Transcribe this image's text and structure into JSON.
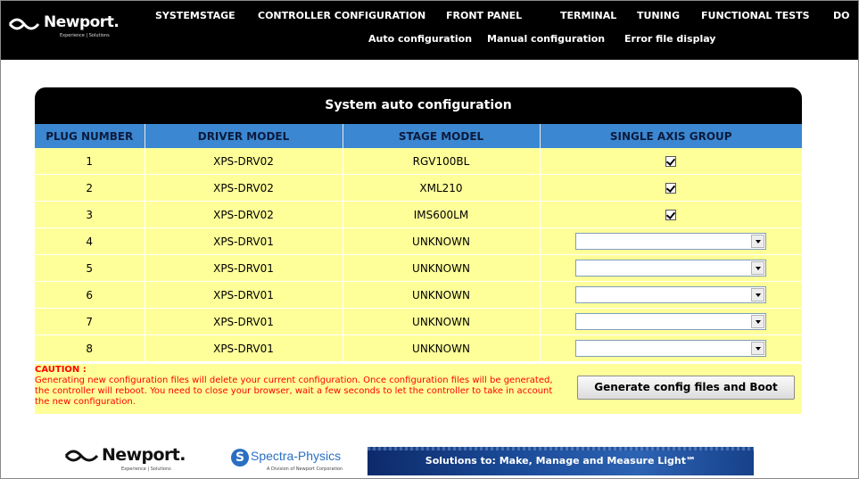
{
  "header": {
    "logo": {
      "name": "Newport.",
      "tagline": "Experience | Solutions"
    },
    "nav": [
      "SYSTEM",
      "STAGE",
      "CONTROLLER CONFIGURATION",
      "FRONT PANEL",
      "TERMINAL",
      "TUNING",
      "FUNCTIONAL TESTS",
      "DO"
    ],
    "subnav": [
      "Auto configuration",
      "Manual configuration",
      "Error file display"
    ]
  },
  "panel": {
    "title": "System auto configuration",
    "columns": [
      "PLUG NUMBER",
      "DRIVER MODEL",
      "STAGE MODEL",
      "SINGLE AXIS GROUP"
    ],
    "rows": [
      {
        "plug": "1",
        "driver": "XPS-DRV02",
        "stage": "RGV100BL",
        "single_axis_group": "checkbox-checked"
      },
      {
        "plug": "2",
        "driver": "XPS-DRV02",
        "stage": "XML210",
        "single_axis_group": "checkbox-checked"
      },
      {
        "plug": "3",
        "driver": "XPS-DRV02",
        "stage": "IMS600LM",
        "single_axis_group": "checkbox-checked"
      },
      {
        "plug": "4",
        "driver": "XPS-DRV01",
        "stage": "UNKNOWN",
        "single_axis_group": "select-empty"
      },
      {
        "plug": "5",
        "driver": "XPS-DRV01",
        "stage": "UNKNOWN",
        "single_axis_group": "select-empty"
      },
      {
        "plug": "6",
        "driver": "XPS-DRV01",
        "stage": "UNKNOWN",
        "single_axis_group": "select-empty"
      },
      {
        "plug": "7",
        "driver": "XPS-DRV01",
        "stage": "UNKNOWN",
        "single_axis_group": "select-empty"
      },
      {
        "plug": "8",
        "driver": "XPS-DRV01",
        "stage": "UNKNOWN",
        "single_axis_group": "select-empty"
      }
    ],
    "caution_title": "CAUTION :",
    "caution_text": "Generating new configuration files will delete your current configuration. Once configuration files will be generated, the controller will reboot. You need to close your browser, wait a few seconds to let the controller to take in account the new configuration.",
    "generate_button": "Generate config files and Boot"
  },
  "footer": {
    "logo1": {
      "name": "Newport.",
      "tagline": "Experience | Solutions"
    },
    "logo2": {
      "name": "Spectra-Physics",
      "tagline": "A Division of Newport Corporation"
    },
    "banner": "Solutions to: Make, Manage and Measure Light℠"
  },
  "colors": {
    "header_bg": "#000000",
    "column_header_bg": "#3b87d1",
    "row_bg": "#ffff99",
    "caution": "#ff0000"
  }
}
